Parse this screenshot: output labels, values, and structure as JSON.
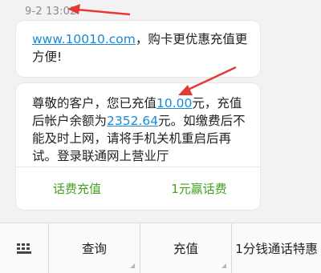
{
  "timestamp": "9-2 13:02",
  "message1": {
    "link": "www.10010.com",
    "text": "，购卡更优惠充值更方便!"
  },
  "message2": {
    "t1": "尊敬的客户，您已充值",
    "amount": "10.00",
    "t2": "元，充值后帐户余额为",
    "balance": "2352.64",
    "t3": "元。如缴费后不能及时上网，请将手机关机重启后再试。登录联通网上营业厅",
    "actions": [
      "话费充值",
      "1元赢话费"
    ]
  },
  "bottom_bar": {
    "keyboard_icon": "keyboard-icon",
    "tabs": [
      "查询",
      "充值",
      "1分钱通话特惠"
    ]
  },
  "colors": {
    "link": "#1a8ad6",
    "action": "#43a31f",
    "arrow": "#e53935"
  }
}
